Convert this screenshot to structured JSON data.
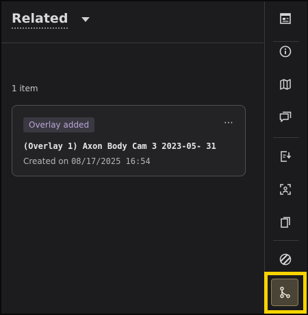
{
  "header": {
    "title": "Related"
  },
  "list": {
    "count_label": "1 item"
  },
  "items": [
    {
      "badge": "Overlay added",
      "title": "(Overlay 1) Axon Body Cam 3 2023-05- 31",
      "created_prefix": "Created on ",
      "created_at": "08/17/2025 16:54",
      "more": "⋯"
    }
  ],
  "rail": {
    "buttons": [
      "details-icon",
      "info-icon",
      "map-icon",
      "comments-icon",
      "transcript-icon",
      "person-detect-icon",
      "copies-icon",
      "redaction-icon",
      "related-icon"
    ]
  },
  "colors": {
    "highlight": "#f7d400",
    "badge_text": "#b9a6d8"
  }
}
